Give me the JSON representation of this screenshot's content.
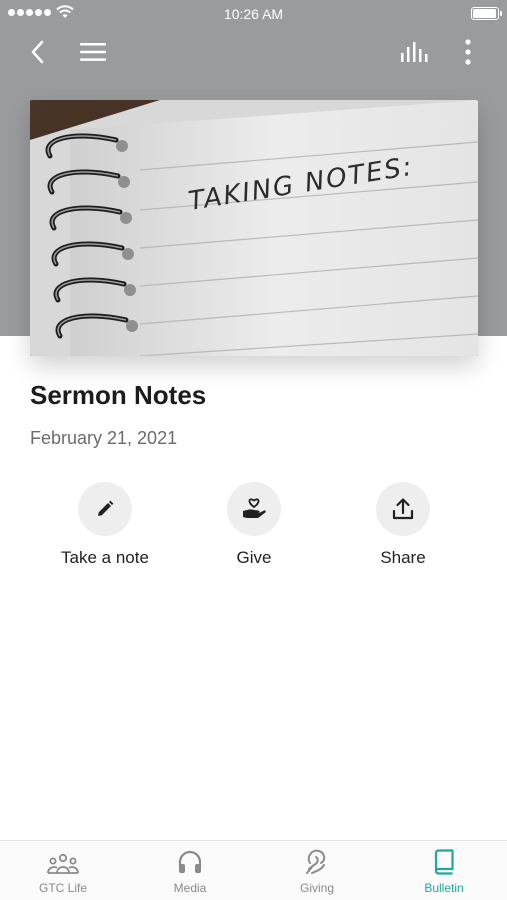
{
  "status_bar": {
    "time": "10:26 AM"
  },
  "nav": {
    "back_icon": "chevron-left-icon",
    "menu_icon": "hamburger-menu-icon",
    "audio_icon": "audio-bars-icon",
    "more_icon": "more-vertical-icon"
  },
  "hero": {
    "handwriting": "TAKING NOTES:"
  },
  "content": {
    "title": "Sermon Notes",
    "date": "February 21, 2021"
  },
  "actions": [
    {
      "label": "Take a note",
      "icon": "pencil-icon"
    },
    {
      "label": "Give",
      "icon": "hand-heart-icon"
    },
    {
      "label": "Share",
      "icon": "share-upload-icon"
    }
  ],
  "tabbar": {
    "active_color": "#1fa89b",
    "inactive_color": "#8a8a8a",
    "tabs": [
      {
        "label": "GTC Life",
        "icon": "people-group-icon"
      },
      {
        "label": "Media",
        "icon": "headphones-icon"
      },
      {
        "label": "Giving",
        "icon": "giving-icon"
      },
      {
        "label": "Bulletin",
        "icon": "book-icon"
      }
    ]
  }
}
